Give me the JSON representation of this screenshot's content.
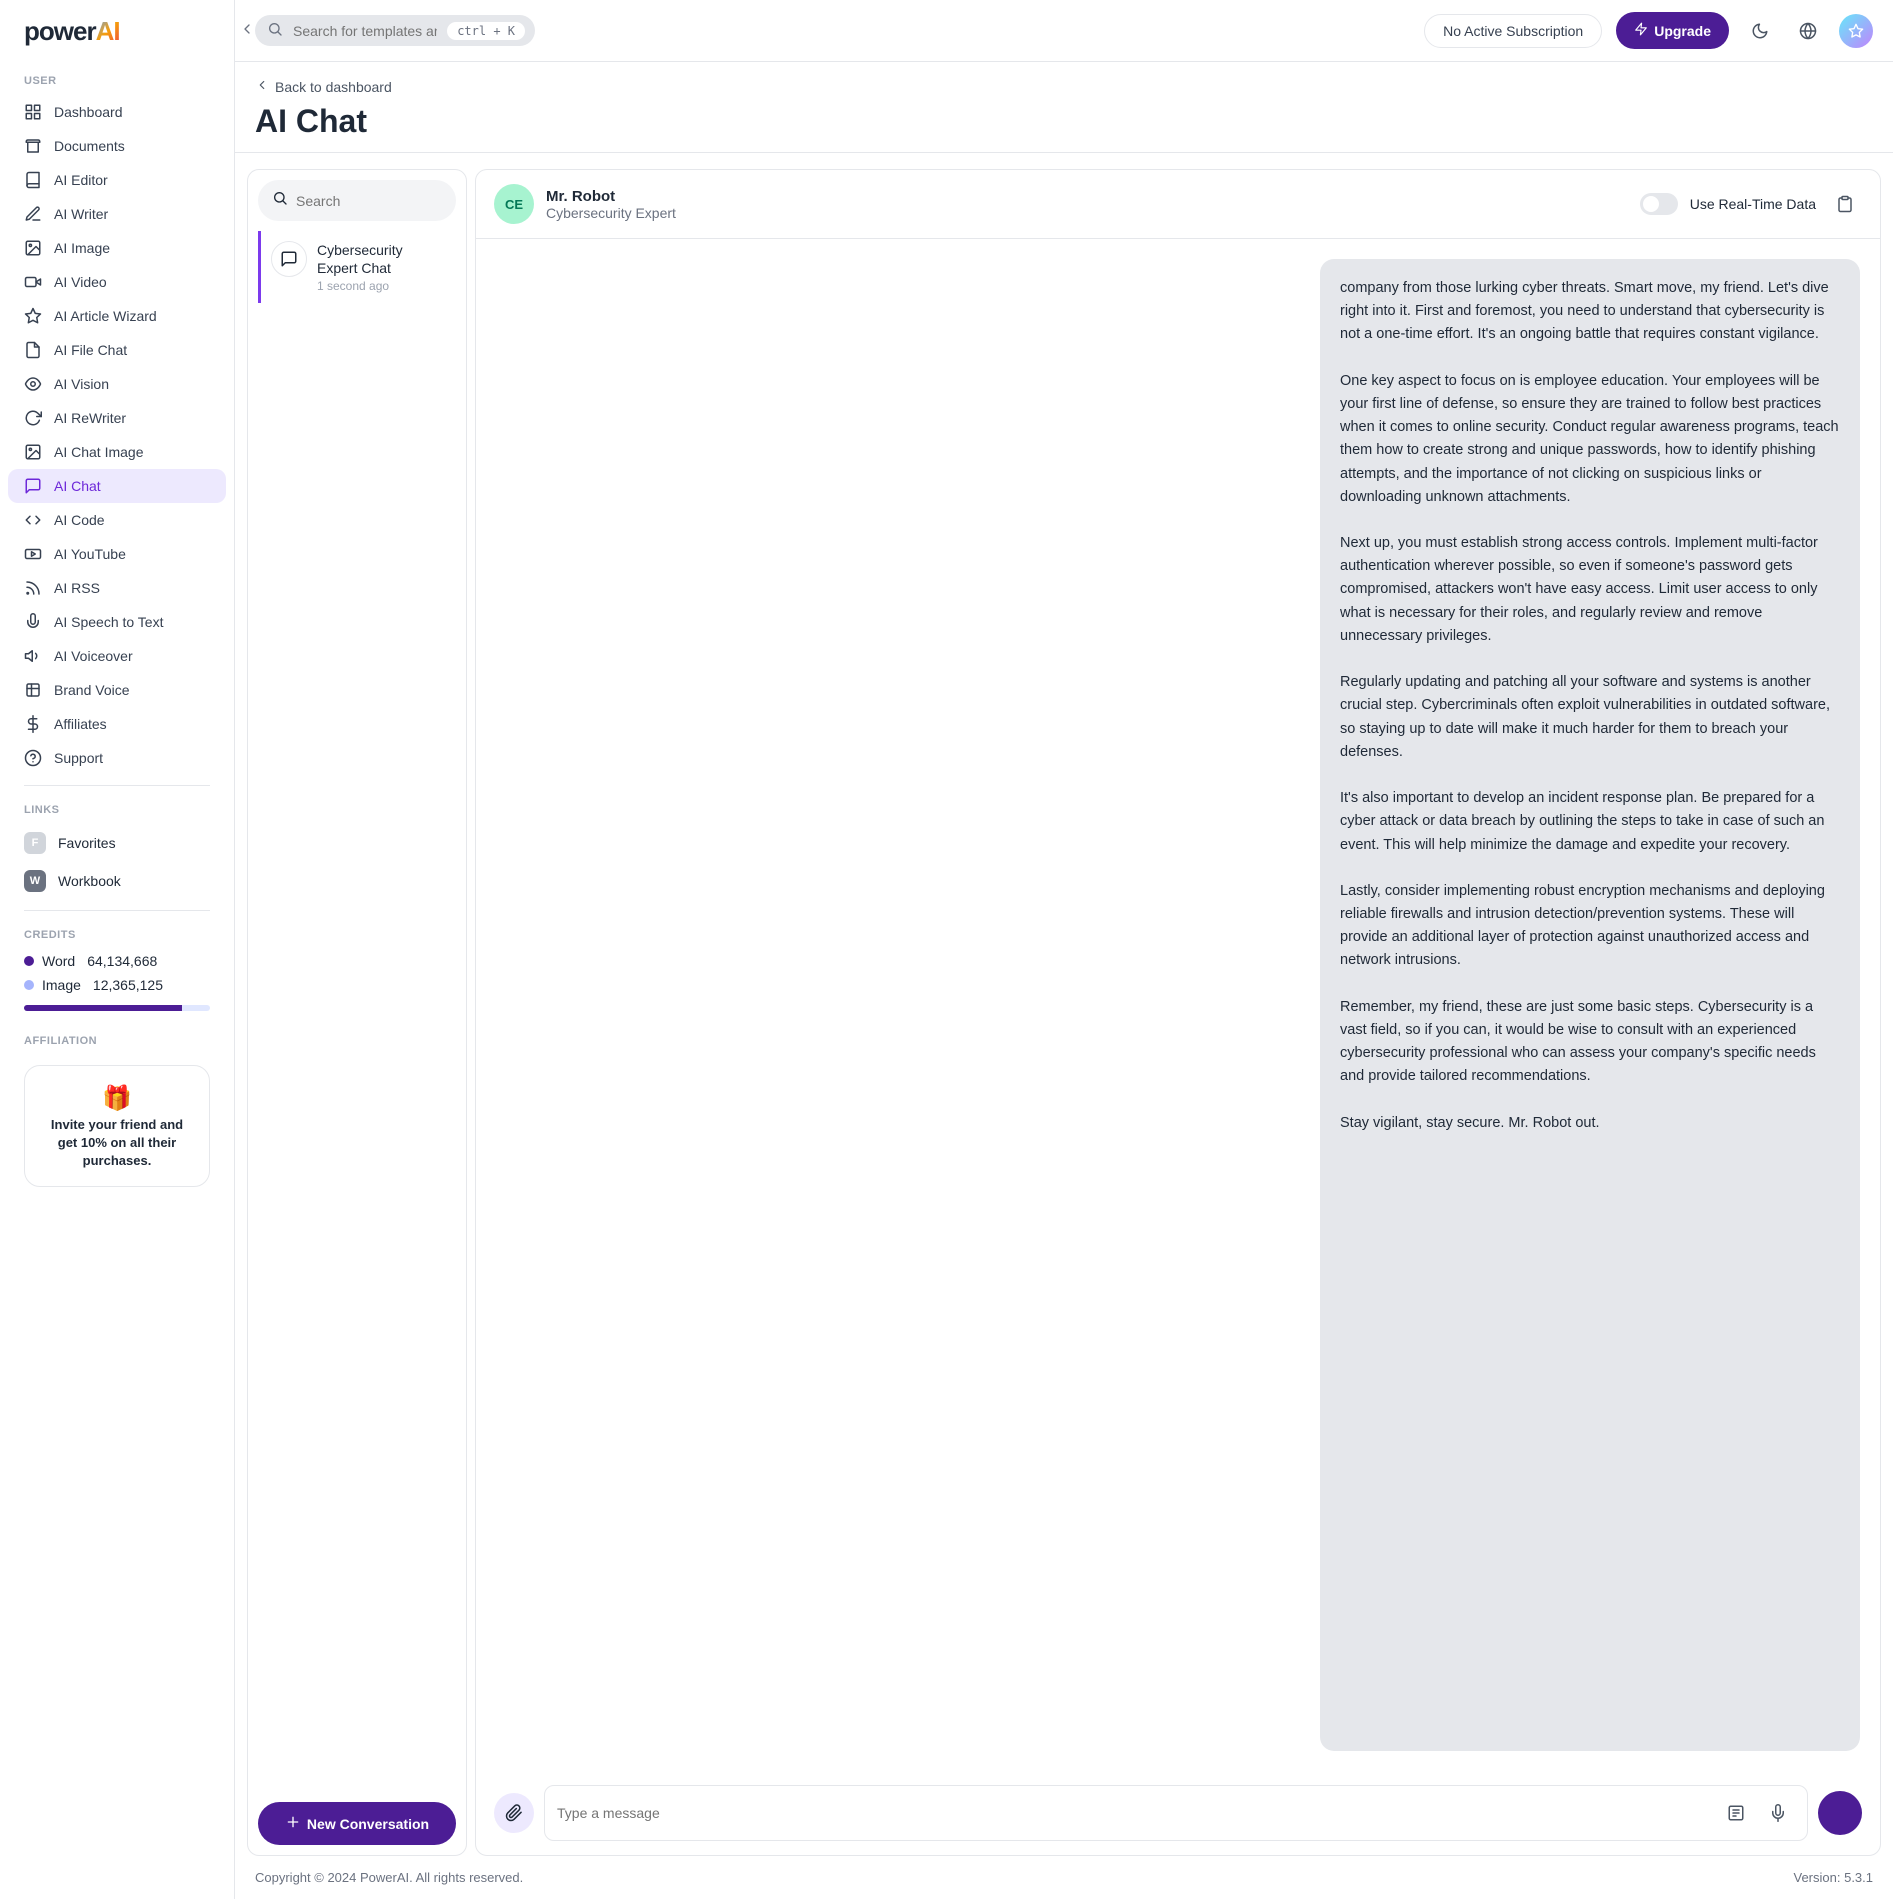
{
  "logo": {
    "text1": "power",
    "text2": "AI"
  },
  "sidebar": {
    "section_user": "USER",
    "items": [
      {
        "label": "Dashboard"
      },
      {
        "label": "Documents"
      },
      {
        "label": "AI Editor"
      },
      {
        "label": "AI Writer"
      },
      {
        "label": "AI Image"
      },
      {
        "label": "AI Video"
      },
      {
        "label": "AI Article Wizard"
      },
      {
        "label": "AI File Chat"
      },
      {
        "label": "AI Vision"
      },
      {
        "label": "AI ReWriter"
      },
      {
        "label": "AI Chat Image"
      },
      {
        "label": "AI Chat"
      },
      {
        "label": "AI Code"
      },
      {
        "label": "AI YouTube"
      },
      {
        "label": "AI RSS"
      },
      {
        "label": "AI Speech to Text"
      },
      {
        "label": "AI Voiceover"
      },
      {
        "label": "Brand Voice"
      },
      {
        "label": "Affiliates"
      },
      {
        "label": "Support"
      }
    ],
    "section_links": "LINKS",
    "links": [
      {
        "badge": "F",
        "color": "#d1d5db",
        "label": "Favorites"
      },
      {
        "badge": "W",
        "color": "#6b7280",
        "label": "Workbook"
      }
    ],
    "section_credits": "CREDITS",
    "credits": [
      {
        "label": "Word",
        "value": "64,134,668",
        "color": "#4c1d95"
      },
      {
        "label": "Image",
        "value": "12,365,125",
        "color": "#a5b4fc"
      }
    ],
    "section_affiliation": "AFFILIATION",
    "affiliation_text": "Invite your friend and get 10% on all their purchases."
  },
  "topbar": {
    "search_placeholder": "Search for templates and documents...",
    "shortcut": "ctrl + K",
    "subscription": "No Active Subscription",
    "upgrade": "Upgrade"
  },
  "page": {
    "back": "Back to dashboard",
    "title": "AI Chat"
  },
  "chatlist": {
    "search_placeholder": "Search",
    "items": [
      {
        "title": "Cybersecurity Expert Chat",
        "time": "1 second ago"
      }
    ],
    "new_conversation": "New Conversation"
  },
  "chat": {
    "persona_initials": "CE",
    "persona_name": "Mr. Robot",
    "persona_subtitle": "Cybersecurity Expert",
    "realtime_label": "Use Real-Time Data",
    "message": "company from those lurking cyber threats. Smart move, my friend. Let's dive right into it. First and foremost, you need to understand that cybersecurity is not a one-time effort. It's an ongoing battle that requires constant vigilance.\n\nOne key aspect to focus on is employee education. Your employees will be your first line of defense, so ensure they are trained to follow best practices when it comes to online security. Conduct regular awareness programs, teach them how to create strong and unique passwords, how to identify phishing attempts, and the importance of not clicking on suspicious links or downloading unknown attachments.\n\nNext up, you must establish strong access controls. Implement multi-factor authentication wherever possible, so even if someone's password gets compromised, attackers won't have easy access. Limit user access to only what is necessary for their roles, and regularly review and remove unnecessary privileges.\n\nRegularly updating and patching all your software and systems is another crucial step. Cybercriminals often exploit vulnerabilities in outdated software, so staying up to date will make it much harder for them to breach your defenses.\n\nIt's also important to develop an incident response plan. Be prepared for a cyber attack or data breach by outlining the steps to take in case of such an event. This will help minimize the damage and expedite your recovery.\n\nLastly, consider implementing robust encryption mechanisms and deploying reliable firewalls and intrusion detection/prevention systems. These will provide an additional layer of protection against unauthorized access and network intrusions.\n\nRemember, my friend, these are just some basic steps. Cybersecurity is a vast field, so if you can, it would be wise to consult with an experienced cybersecurity professional who can assess your company's specific needs and provide tailored recommendations.\n\nStay vigilant, stay secure. Mr. Robot out.",
    "input_placeholder": "Type a message"
  },
  "footer": {
    "copyright": "Copyright © 2024 PowerAI. All rights reserved.",
    "version": "Version: 5.3.1"
  }
}
